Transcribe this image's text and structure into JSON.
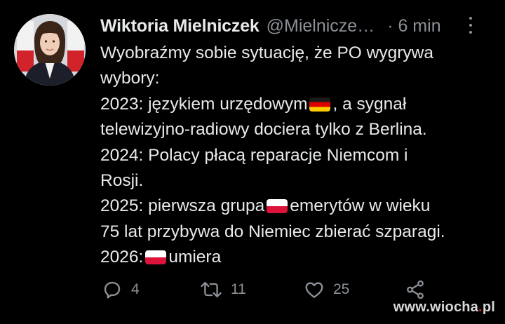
{
  "author": {
    "name": "Wiktoria Mielniczek",
    "handle": "@Mielnicze…",
    "time": "· 6 min"
  },
  "tweet": {
    "lines": [
      [
        {
          "t": "Wyobraźmy sobie sytuację, że PO wygrywa"
        }
      ],
      [
        {
          "t": "wybory:"
        }
      ],
      [
        {
          "t": "2023: językiem urzędowym"
        },
        {
          "flag": "de"
        },
        {
          "t": ", a sygnał"
        }
      ],
      [
        {
          "t": "telewizyjno-radiowy dociera tylko z Berlina."
        }
      ],
      [
        {
          "t": "2024: Polacy płacą reparacje Niemcom i"
        }
      ],
      [
        {
          "t": "Rosji."
        }
      ],
      [
        {
          "t": "2025: pierwsza grupa"
        },
        {
          "flag": "pl"
        },
        {
          "t": "emerytów w wieku"
        }
      ],
      [
        {
          "t": "75 lat przybywa do Niemiec zbierać szparagi."
        }
      ],
      [
        {
          "t": "2026:"
        },
        {
          "flag": "pl"
        },
        {
          "t": "umiera"
        }
      ]
    ]
  },
  "actions": {
    "reply_count": "4",
    "retweet_count": "11",
    "like_count": "25"
  },
  "icons": {
    "flag_de": "germany-flag-icon",
    "flag_pl": "poland-flag-icon"
  },
  "watermark": {
    "pre": "www.",
    "brand": "wiocha",
    "dot": ".",
    "tld": "pl"
  }
}
